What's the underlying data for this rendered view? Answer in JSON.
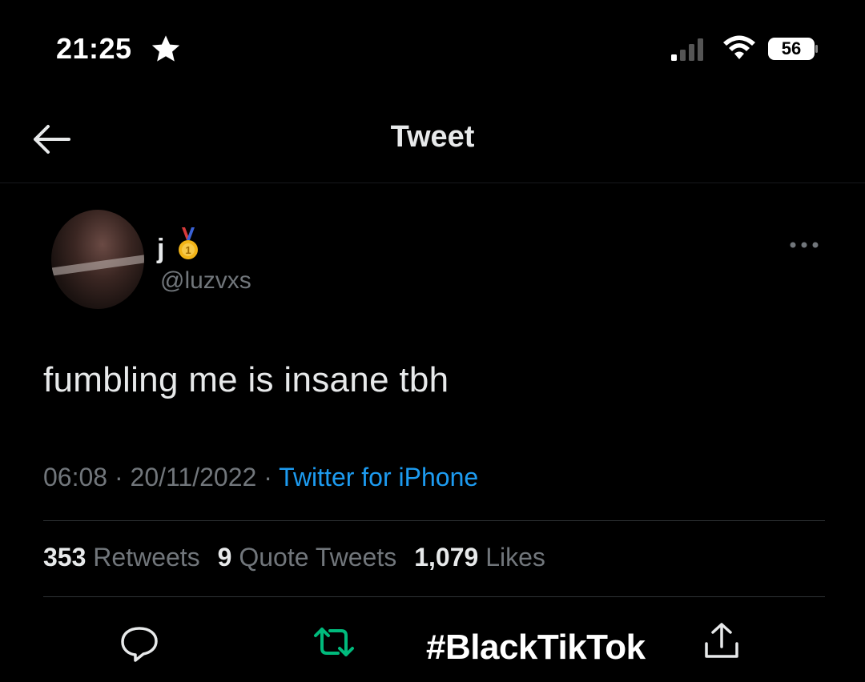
{
  "status_bar": {
    "time": "21:25",
    "battery": "56",
    "icons": [
      "star-icon",
      "signal-icon",
      "wifi-icon",
      "battery-icon"
    ]
  },
  "header": {
    "title": "Tweet",
    "back_icon": "arrow-left-icon"
  },
  "tweet": {
    "display_name": "j",
    "badge_icon": "medal-icon",
    "handle": "@luzvxs",
    "text": "fumbling me is insane tbh",
    "time": "06:08",
    "separator": "·",
    "date": "20/11/2022",
    "source": "Twitter for iPhone",
    "more_icon": "more-dots-icon"
  },
  "stats": {
    "retweets_count": "353",
    "retweets_label": "Retweets",
    "quotes_count": "9",
    "quotes_label": "Quote Tweets",
    "likes_count": "1,079",
    "likes_label": "Likes"
  },
  "actions": [
    "reply-icon",
    "retweet-icon",
    "share-icon"
  ],
  "watermark": "#BlackTikTok",
  "colors": {
    "background": "#000000",
    "text_primary": "#e7e9ea",
    "text_secondary": "#71767b",
    "link": "#1d9bf0",
    "retweet_accent": "#00ba7c",
    "divider": "#2f3336"
  }
}
